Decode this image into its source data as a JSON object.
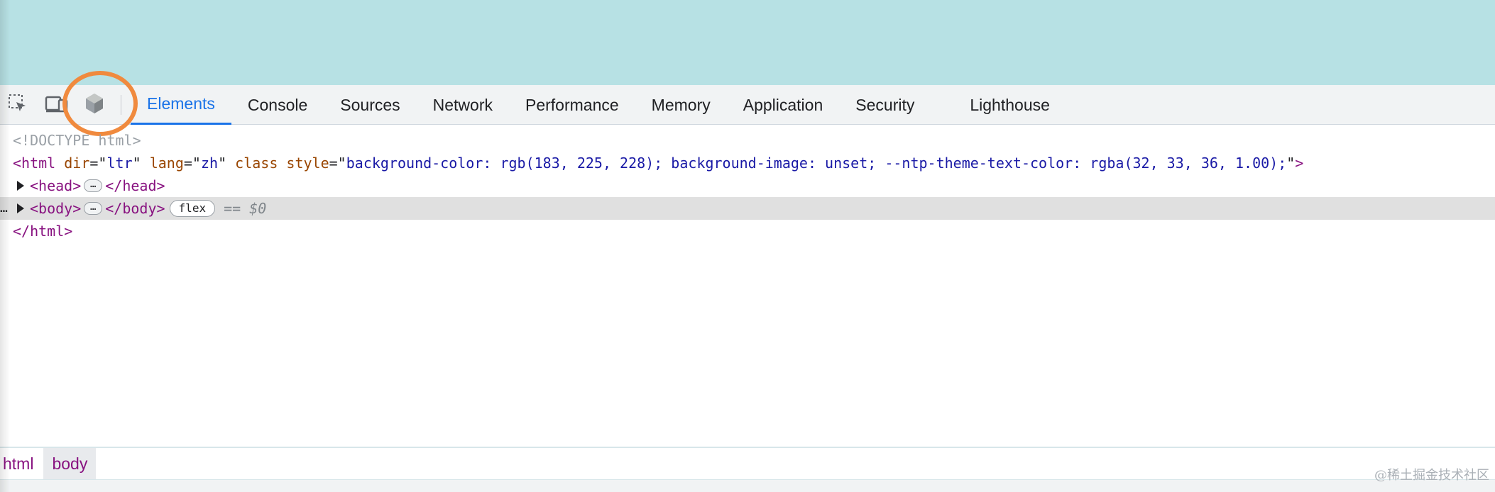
{
  "colors": {
    "page_background": "#b7e1e4",
    "active_tab": "#1a73e8",
    "highlight_ring": "#f08a3e",
    "tag": "#881280",
    "attr_name": "#994500",
    "attr_value": "#1a1aa6"
  },
  "toolbar": {
    "tools": [
      {
        "icon": "inspect-element-icon"
      },
      {
        "icon": "device-toolbar-icon"
      },
      {
        "icon": "extension-cube-icon"
      }
    ],
    "tabs": [
      {
        "label": "Elements",
        "active": true
      },
      {
        "label": "Console"
      },
      {
        "label": "Sources"
      },
      {
        "label": "Network"
      },
      {
        "label": "Performance"
      },
      {
        "label": "Memory"
      },
      {
        "label": "Application"
      },
      {
        "label": "Security"
      },
      {
        "label": "Lighthouse"
      }
    ]
  },
  "dom": {
    "doctype": "<!DOCTYPE html>",
    "html_open": {
      "tag_open": "<html",
      "attrs": [
        {
          "name": "dir",
          "value": "ltr"
        },
        {
          "name": "lang",
          "value": "zh"
        },
        {
          "name": "class",
          "value": ""
        },
        {
          "name": "style",
          "value": "background-color: rgb(183, 225, 228); background-image: unset; --ntp-theme-text-color: rgba(32, 33, 36, 1.00);"
        }
      ],
      "tag_close": ">"
    },
    "head": {
      "open": "<head>",
      "ellipsis": "…",
      "close": "</head>"
    },
    "body": {
      "open": "<body>",
      "ellipsis": "…",
      "close": "</body>",
      "badge": "flex",
      "ref": "== $0",
      "row_dots": "…"
    },
    "html_close": "</html>"
  },
  "breadcrumbs": [
    {
      "label": "html"
    },
    {
      "label": "body",
      "active": true
    }
  ],
  "watermark": "@稀土掘金技术社区"
}
